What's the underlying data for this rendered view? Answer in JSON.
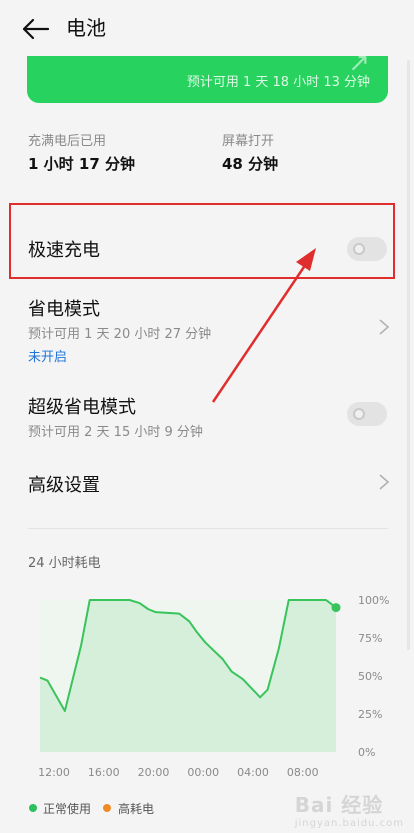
{
  "header": {
    "title": "电池"
  },
  "battery_card": {
    "estimate": "预计可用 1 天 18 小时 13 分钟",
    "glyph": "↗"
  },
  "stats": [
    {
      "label": "充满电后已用",
      "value": "1 小时 17 分钟"
    },
    {
      "label": "屏幕打开",
      "value": "48 分钟"
    }
  ],
  "settings": {
    "fast_charge": {
      "label": "极速充电",
      "enabled": false
    },
    "power_saving": {
      "label": "省电模式",
      "estimate": "预计可用 1 天 20 小时 27 分钟",
      "status": "未开启"
    },
    "super_power_saving": {
      "label": "超级省电模式",
      "estimate": "预计可用 2 天 15 小时 9 分钟",
      "enabled": false
    },
    "advanced": {
      "label": "高级设置"
    }
  },
  "chart_title": "24 小时耗电",
  "chart_data": {
    "type": "area",
    "title": "24 小时耗电",
    "x_ticks": [
      "12:00",
      "16:00",
      "20:00",
      "00:00",
      "04:00",
      "08:00"
    ],
    "y_ticks": [
      "100%",
      "75%",
      "50%",
      "25%",
      "0%"
    ],
    "ylim": [
      0,
      100
    ],
    "x_range_hours": [
      0,
      23.8
    ],
    "series": [
      {
        "name": "正常使用",
        "color": "#38c45a",
        "points": [
          [
            0.0,
            49
          ],
          [
            0.6,
            47
          ],
          [
            2.0,
            27
          ],
          [
            3.3,
            70
          ],
          [
            4.0,
            100
          ],
          [
            7.2,
            100
          ],
          [
            8.0,
            98
          ],
          [
            8.7,
            94
          ],
          [
            9.3,
            92
          ],
          [
            11.2,
            91
          ],
          [
            12.0,
            86
          ],
          [
            12.6,
            79
          ],
          [
            13.3,
            72
          ],
          [
            14.7,
            61
          ],
          [
            15.4,
            53
          ],
          [
            16.3,
            48
          ],
          [
            17.7,
            36
          ],
          [
            18.3,
            41
          ],
          [
            19.2,
            68
          ],
          [
            20.0,
            100
          ],
          [
            23.0,
            100
          ],
          [
            23.8,
            95
          ]
        ]
      },
      {
        "name": "高耗电",
        "color": "#f08a24",
        "points": []
      }
    ],
    "legend_position": "bottom-left"
  },
  "legend": [
    {
      "label": "正常使用",
      "color": "#2ec05c"
    },
    {
      "label": "高耗电",
      "color": "#f08a24"
    }
  ],
  "annotation_color": "#e02e2e",
  "watermark": {
    "text": "Bai 经验",
    "sub": "jingyan.baidu.com"
  }
}
